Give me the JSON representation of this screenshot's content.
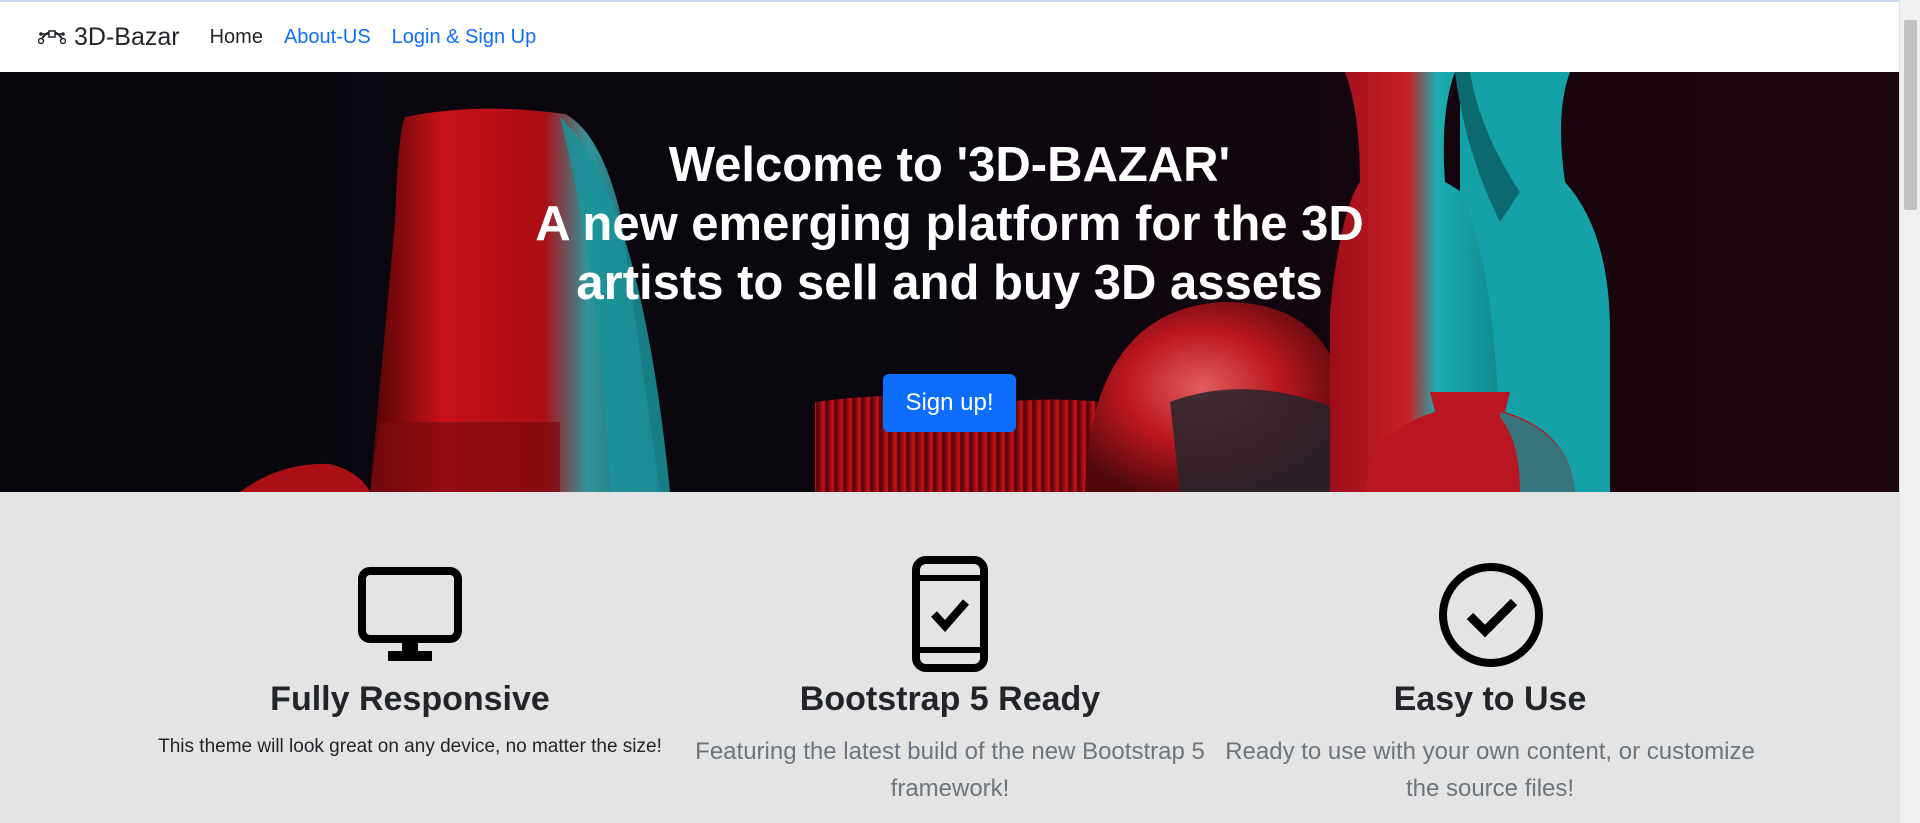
{
  "navbar": {
    "brand": "3D-Bazar",
    "links": [
      {
        "label": "Home"
      },
      {
        "label": "About-US"
      },
      {
        "label": "Login & Sign Up"
      }
    ]
  },
  "hero": {
    "title_lines": [
      "Welcome to '3D-BAZAR'",
      "A new emerging platform for the 3D",
      "artists to sell and buy 3D assets"
    ],
    "signup_label": "Sign up!"
  },
  "features": [
    {
      "icon": "monitor-icon",
      "title": "Fully Responsive",
      "text": "This theme will look great on any device, no matter the size!"
    },
    {
      "icon": "phone-check-icon",
      "title": "Bootstrap 5 Ready",
      "text": "Featuring the latest build of the new Bootstrap 5 framework!"
    },
    {
      "icon": "check-circle-icon",
      "title": "Easy to Use",
      "text": "Ready to use with your own content, or customize the source files!"
    }
  ],
  "colors": {
    "primary": "#0d6efd",
    "features_bg": "#e4e4e4",
    "hero_red": "#e3141c",
    "hero_cyan": "#1fc6c9"
  }
}
